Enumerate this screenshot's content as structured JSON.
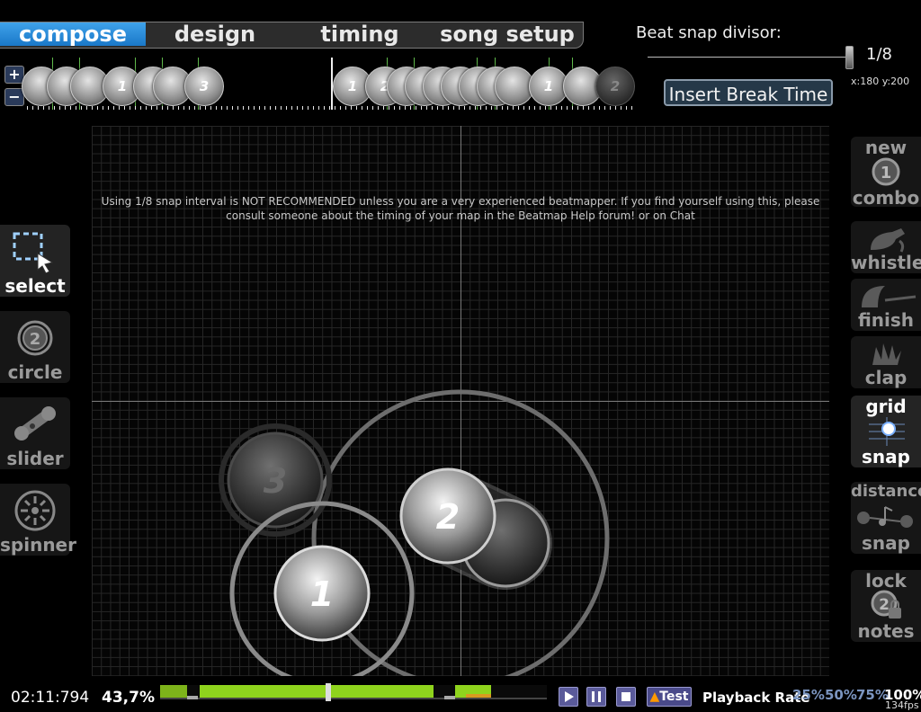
{
  "tabs": [
    {
      "label": "compose",
      "active": true
    },
    {
      "label": "design",
      "active": false
    },
    {
      "label": "timing",
      "active": false
    },
    {
      "label": "song setup",
      "active": false
    }
  ],
  "beat_snap": {
    "label": "Beat snap divisor:",
    "value": "1/8"
  },
  "coords": "x:180 y:200",
  "insert_break_label": "Insert Break Time",
  "zoom": {
    "in": "+",
    "out": "−"
  },
  "timeline_numbers": [
    "1",
    "3",
    "1",
    "2",
    "1",
    "2"
  ],
  "warning": "Using 1/8 snap interval is NOT RECOMMENDED unless you are a very experienced beatmapper.  If you find yourself using this, please consult someone about the timing of your map in the Beatmap Help forum! or on Chat",
  "tools": [
    {
      "label": "select",
      "icon": "select-icon",
      "active": true
    },
    {
      "label": "circle",
      "icon": "circle-icon",
      "active": false
    },
    {
      "label": "slider",
      "icon": "slider-icon",
      "active": false
    },
    {
      "label": "spinner",
      "icon": "spinner-icon",
      "active": false
    }
  ],
  "toggles": {
    "new_combo": {
      "line1": "new",
      "line2": "combo",
      "icon_text": "1"
    },
    "whistle": "whistle",
    "finish": "finish",
    "clap": "clap",
    "grid_snap": {
      "line1": "grid",
      "line2": "snap"
    },
    "distance_snap": {
      "line1": "distance",
      "line2": "snap"
    },
    "lock_notes": {
      "line1": "lock",
      "line2": "notes",
      "icon_text": "2"
    }
  },
  "hit_objects": [
    {
      "number": "3",
      "faded": true
    },
    {
      "number": "2",
      "faded": false
    },
    {
      "number": "1",
      "faded": false
    }
  ],
  "status": {
    "time": "02:11:794",
    "percent": "43,7%"
  },
  "playback": {
    "test_label": "Test",
    "rate_label": "Playback Rate",
    "rates": [
      {
        "label": "25%",
        "active": false
      },
      {
        "label": "50%",
        "active": false
      },
      {
        "label": "75%",
        "active": false
      },
      {
        "label": "100%",
        "active": true
      }
    ]
  },
  "fps": "134fps",
  "colors": {
    "accent": "#2a8ede",
    "timeline_green": "#8fd31d",
    "grid": "#262626"
  }
}
